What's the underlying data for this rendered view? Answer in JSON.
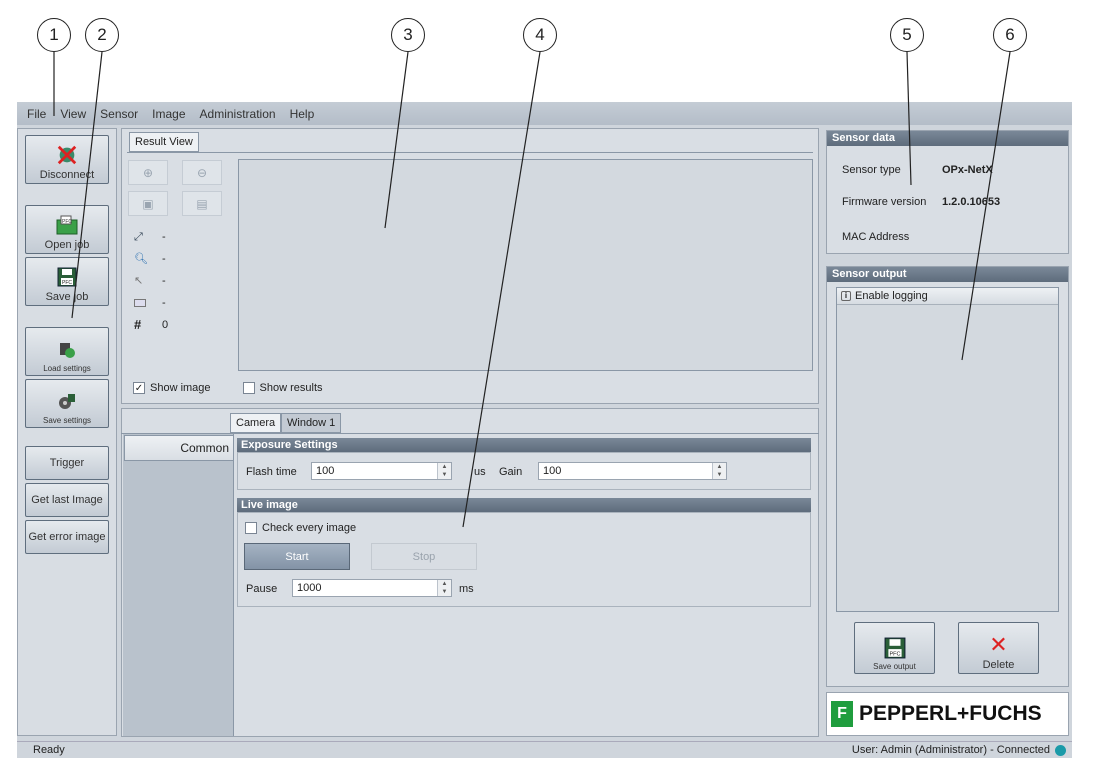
{
  "callouts": [
    "1",
    "2",
    "3",
    "4",
    "5",
    "6"
  ],
  "menu": [
    "File",
    "View",
    "Sensor",
    "Image",
    "Administration",
    "Help"
  ],
  "toolbar": {
    "disconnect": "Disconnect",
    "open_job": "Open job",
    "save_job": "Save job",
    "load_settings": "Load settings",
    "save_settings": "Save settings",
    "trigger": "Trigger",
    "get_last_image": "Get last Image",
    "get_error_image": "Get error image"
  },
  "result_view": {
    "tab": "Result View",
    "stats": [
      {
        "icon": "resize-icon",
        "value": "-"
      },
      {
        "icon": "magnifier-icon",
        "value": "-"
      },
      {
        "icon": "cursor-icon",
        "value": "-"
      },
      {
        "icon": "color-swatch-icon",
        "value": "-"
      },
      {
        "icon": "hash-icon",
        "symbol": "#",
        "value": "0"
      }
    ],
    "show_image": "Show image",
    "show_image_checked": true,
    "show_results": "Show results",
    "show_results_checked": false
  },
  "settings": {
    "tabs": [
      "Camera",
      "Window 1"
    ],
    "active_tab": "Camera",
    "side_item": "Common",
    "exposure": {
      "title": "Exposure Settings",
      "flash_label": "Flash time",
      "flash_value": "100",
      "flash_unit": "us",
      "gain_label": "Gain",
      "gain_value": "100"
    },
    "live": {
      "title": "Live image",
      "check_every": "Check every image",
      "start": "Start",
      "stop": "Stop",
      "pause_label": "Pause",
      "pause_value": "1000",
      "pause_unit": "ms"
    }
  },
  "sensor_data": {
    "title": "Sensor data",
    "type_label": "Sensor type",
    "type_value": "OPx-NetX",
    "firmware_label": "Firmware version",
    "firmware_value": "1.2.0.10653",
    "mac_label": "MAC Address",
    "mac_value": ""
  },
  "sensor_output": {
    "title": "Sensor output",
    "enable_logging": "Enable logging",
    "save_output": "Save output",
    "delete": "Delete"
  },
  "logo": "PEPPERL+FUCHS",
  "status": {
    "left": "Ready",
    "right": "User: Admin (Administrator) - Connected"
  },
  "colors": {
    "accent": "#1a9aa8",
    "logo_green": "#1f9d3e",
    "header": "#5e6c7c"
  }
}
